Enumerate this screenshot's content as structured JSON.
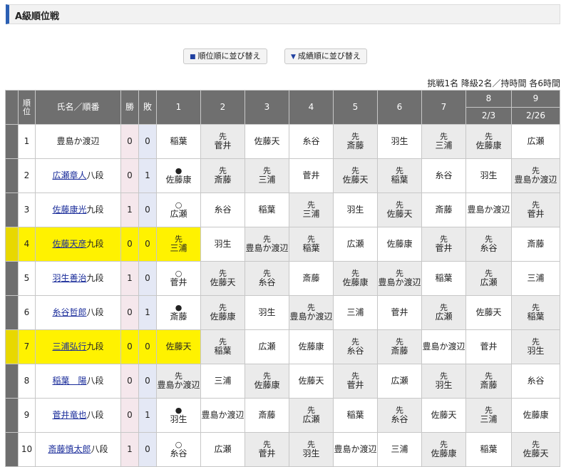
{
  "title": "A級順位戦",
  "buttons": {
    "rank_sort": "順位順に並び替え",
    "score_sort": "成績順に並び替え"
  },
  "note": "挑戦1名 降級2名／持時間 各6時間",
  "headers": {
    "rank": "順位",
    "name": "氏名／順番",
    "win": "勝",
    "loss": "敗",
    "rounds": [
      "1",
      "2",
      "3",
      "4",
      "5",
      "6",
      "7",
      "8",
      "9"
    ],
    "dates": {
      "8": "2/3",
      "9": "2/26"
    }
  },
  "players": [
    {
      "rank": "1",
      "link": "",
      "name_suffix": "豊島か渡辺",
      "wins": "0",
      "losses": "0",
      "highlight": false,
      "games": [
        {
          "mark": "",
          "opp": "稲葉"
        },
        {
          "mark": "先",
          "opp": "菅井"
        },
        {
          "mark": "",
          "opp": "佐藤天"
        },
        {
          "mark": "",
          "opp": "糸谷"
        },
        {
          "mark": "先",
          "opp": "斎藤"
        },
        {
          "mark": "",
          "opp": "羽生"
        },
        {
          "mark": "先",
          "opp": "三浦"
        },
        {
          "mark": "先",
          "opp": "佐藤康"
        },
        {
          "mark": "",
          "opp": "広瀬"
        }
      ]
    },
    {
      "rank": "2",
      "link": "広瀬章人",
      "name_suffix": "八段",
      "wins": "0",
      "losses": "1",
      "highlight": false,
      "games": [
        {
          "mark": "●",
          "opp": "佐藤康"
        },
        {
          "mark": "先",
          "opp": "斎藤"
        },
        {
          "mark": "先",
          "opp": "三浦"
        },
        {
          "mark": "",
          "opp": "菅井"
        },
        {
          "mark": "先",
          "opp": "佐藤天"
        },
        {
          "mark": "先",
          "opp": "稲葉"
        },
        {
          "mark": "",
          "opp": "糸谷"
        },
        {
          "mark": "",
          "opp": "羽生"
        },
        {
          "mark": "先",
          "opp": "豊島か渡辺"
        }
      ]
    },
    {
      "rank": "3",
      "link": "佐藤康光",
      "name_suffix": "九段",
      "wins": "1",
      "losses": "0",
      "highlight": false,
      "games": [
        {
          "mark": "○",
          "opp": "広瀬"
        },
        {
          "mark": "",
          "opp": "糸谷"
        },
        {
          "mark": "",
          "opp": "稲葉"
        },
        {
          "mark": "先",
          "opp": "三浦"
        },
        {
          "mark": "",
          "opp": "羽生"
        },
        {
          "mark": "先",
          "opp": "佐藤天"
        },
        {
          "mark": "",
          "opp": "斎藤"
        },
        {
          "mark": "",
          "opp": "豊島か渡辺"
        },
        {
          "mark": "先",
          "opp": "菅井"
        }
      ]
    },
    {
      "rank": "4",
      "link": "佐藤天彦",
      "name_suffix": "九段",
      "wins": "0",
      "losses": "0",
      "highlight": true,
      "games": [
        {
          "mark": "先",
          "opp": "三浦"
        },
        {
          "mark": "",
          "opp": "羽生"
        },
        {
          "mark": "先",
          "opp": "豊島か渡辺"
        },
        {
          "mark": "先",
          "opp": "稲葉"
        },
        {
          "mark": "",
          "opp": "広瀬"
        },
        {
          "mark": "",
          "opp": "佐藤康"
        },
        {
          "mark": "先",
          "opp": "菅井"
        },
        {
          "mark": "先",
          "opp": "糸谷"
        },
        {
          "mark": "",
          "opp": "斎藤"
        }
      ]
    },
    {
      "rank": "5",
      "link": "羽生善治",
      "name_suffix": "九段",
      "wins": "1",
      "losses": "0",
      "highlight": false,
      "games": [
        {
          "mark": "○",
          "opp": "菅井"
        },
        {
          "mark": "先",
          "opp": "佐藤天"
        },
        {
          "mark": "先",
          "opp": "糸谷"
        },
        {
          "mark": "",
          "opp": "斎藤"
        },
        {
          "mark": "先",
          "opp": "佐藤康"
        },
        {
          "mark": "先",
          "opp": "豊島か渡辺"
        },
        {
          "mark": "",
          "opp": "稲葉"
        },
        {
          "mark": "先",
          "opp": "広瀬"
        },
        {
          "mark": "",
          "opp": "三浦"
        }
      ]
    },
    {
      "rank": "6",
      "link": "糸谷哲郎",
      "name_suffix": "八段",
      "wins": "0",
      "losses": "1",
      "highlight": false,
      "games": [
        {
          "mark": "●",
          "opp": "斎藤"
        },
        {
          "mark": "先",
          "opp": "佐藤康"
        },
        {
          "mark": "",
          "opp": "羽生"
        },
        {
          "mark": "先",
          "opp": "豊島か渡辺"
        },
        {
          "mark": "",
          "opp": "三浦"
        },
        {
          "mark": "",
          "opp": "菅井"
        },
        {
          "mark": "先",
          "opp": "広瀬"
        },
        {
          "mark": "",
          "opp": "佐藤天"
        },
        {
          "mark": "先",
          "opp": "稲葉"
        }
      ]
    },
    {
      "rank": "7",
      "link": "三浦弘行",
      "name_suffix": "九段",
      "wins": "0",
      "losses": "0",
      "highlight": true,
      "games": [
        {
          "mark": "",
          "opp": "佐藤天"
        },
        {
          "mark": "先",
          "opp": "稲葉"
        },
        {
          "mark": "",
          "opp": "広瀬"
        },
        {
          "mark": "",
          "opp": "佐藤康"
        },
        {
          "mark": "先",
          "opp": "糸谷"
        },
        {
          "mark": "先",
          "opp": "斎藤"
        },
        {
          "mark": "",
          "opp": "豊島か渡辺"
        },
        {
          "mark": "",
          "opp": "菅井"
        },
        {
          "mark": "先",
          "opp": "羽生"
        }
      ]
    },
    {
      "rank": "8",
      "link": "稲葉　陽",
      "name_suffix": "八段",
      "wins": "0",
      "losses": "0",
      "highlight": false,
      "games": [
        {
          "mark": "先",
          "opp": "豊島か渡辺"
        },
        {
          "mark": "",
          "opp": "三浦"
        },
        {
          "mark": "先",
          "opp": "佐藤康"
        },
        {
          "mark": "",
          "opp": "佐藤天"
        },
        {
          "mark": "先",
          "opp": "菅井"
        },
        {
          "mark": "",
          "opp": "広瀬"
        },
        {
          "mark": "先",
          "opp": "羽生"
        },
        {
          "mark": "先",
          "opp": "斎藤"
        },
        {
          "mark": "",
          "opp": "糸谷"
        }
      ]
    },
    {
      "rank": "9",
      "link": "菅井竜也",
      "name_suffix": "八段",
      "wins": "0",
      "losses": "1",
      "highlight": false,
      "games": [
        {
          "mark": "●",
          "opp": "羽生"
        },
        {
          "mark": "",
          "opp": "豊島か渡辺"
        },
        {
          "mark": "",
          "opp": "斎藤"
        },
        {
          "mark": "先",
          "opp": "広瀬"
        },
        {
          "mark": "",
          "opp": "稲葉"
        },
        {
          "mark": "先",
          "opp": "糸谷"
        },
        {
          "mark": "",
          "opp": "佐藤天"
        },
        {
          "mark": "先",
          "opp": "三浦"
        },
        {
          "mark": "",
          "opp": "佐藤康"
        }
      ]
    },
    {
      "rank": "10",
      "link": "斎藤慎太郎",
      "name_suffix": "八段",
      "wins": "1",
      "losses": "0",
      "highlight": false,
      "games": [
        {
          "mark": "○",
          "opp": "糸谷"
        },
        {
          "mark": "",
          "opp": "広瀬"
        },
        {
          "mark": "先",
          "opp": "菅井"
        },
        {
          "mark": "先",
          "opp": "羽生"
        },
        {
          "mark": "",
          "opp": "豊島か渡辺"
        },
        {
          "mark": "",
          "opp": "三浦"
        },
        {
          "mark": "先",
          "opp": "佐藤康"
        },
        {
          "mark": "",
          "opp": "稲葉"
        },
        {
          "mark": "先",
          "opp": "佐藤天"
        }
      ]
    }
  ],
  "colors": {
    "accent": "#2b5fb3",
    "highlight": "#fff200",
    "header_bg": "#6f6f6f",
    "link": "#1a2c9a"
  }
}
